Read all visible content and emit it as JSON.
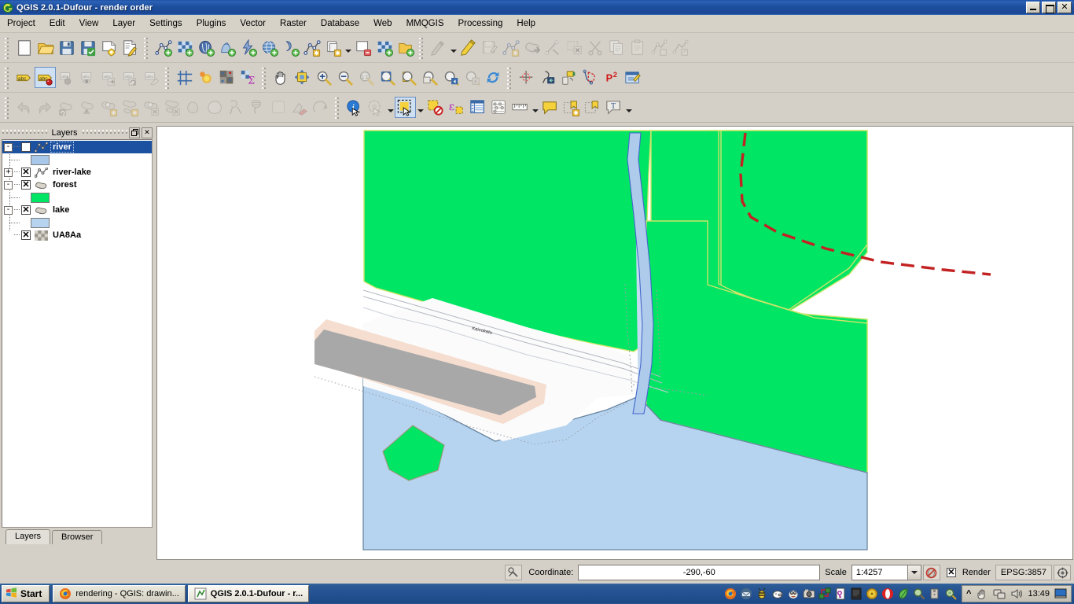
{
  "window": {
    "title": "QGIS 2.0.1-Dufour - render order",
    "app_icon": "qgis-icon",
    "buttons": {
      "minimize": "minimize-button",
      "maximize": "maximize-button",
      "close": "close-button"
    }
  },
  "menubar": {
    "items": [
      {
        "label": "Project"
      },
      {
        "label": "Edit"
      },
      {
        "label": "View"
      },
      {
        "label": "Layer"
      },
      {
        "label": "Settings"
      },
      {
        "label": "Plugins"
      },
      {
        "label": "Vector"
      },
      {
        "label": "Raster"
      },
      {
        "label": "Database"
      },
      {
        "label": "Web"
      },
      {
        "label": "MMQGIS"
      },
      {
        "label": "Processing"
      },
      {
        "label": "Help"
      }
    ]
  },
  "toolbars": {
    "row1": [
      {
        "icon": "grip"
      },
      {
        "icon": "new-project-icon"
      },
      {
        "icon": "open-project-icon"
      },
      {
        "icon": "save-project-icon"
      },
      {
        "icon": "save-project-as-icon"
      },
      {
        "icon": "new-print-composer-icon"
      },
      {
        "icon": "composer-manager-icon"
      },
      {
        "icon": "grip"
      },
      {
        "icon": "add-vector-layer-icon"
      },
      {
        "icon": "add-raster-layer-icon"
      },
      {
        "icon": "add-postgis-layer-icon"
      },
      {
        "icon": "add-spatialite-layer-icon"
      },
      {
        "icon": "add-mssql-layer-icon"
      },
      {
        "icon": "add-wcs-layer-icon"
      },
      {
        "icon": "add-wms-layer-icon"
      },
      {
        "icon": "add-delimited-text-layer-icon"
      },
      {
        "icon": "new-shapefile-layer-icon"
      },
      {
        "icon": "new-shapefile-dropdown",
        "type": "caret"
      },
      {
        "icon": "layer-properties-icon"
      },
      {
        "icon": "remove-layer-icon"
      },
      {
        "icon": "add-group-icon"
      },
      {
        "icon": "grip"
      },
      {
        "icon": "toggle-editing-icon",
        "disabled": true
      },
      {
        "icon": "toggle-editing-dropdown",
        "type": "caret"
      },
      {
        "icon": "current-edits-icon"
      },
      {
        "icon": "save-layer-edits-icon",
        "disabled": true
      },
      {
        "icon": "add-feature-icon",
        "disabled": true
      },
      {
        "icon": "move-feature-icon",
        "disabled": true
      },
      {
        "icon": "node-tool-icon",
        "disabled": true
      },
      {
        "icon": "delete-selected-icon",
        "disabled": true
      },
      {
        "icon": "cut-features-icon",
        "disabled": true
      },
      {
        "icon": "copy-features-icon",
        "disabled": true
      },
      {
        "icon": "paste-features-icon",
        "disabled": true
      },
      {
        "icon": "undo-edits-icon",
        "disabled": true
      },
      {
        "icon": "redo-edits-icon",
        "disabled": true
      }
    ],
    "row2": [
      {
        "icon": "grip"
      },
      {
        "icon": "label-icon"
      },
      {
        "icon": "label-stop-icon",
        "selected": true
      },
      {
        "icon": "label-pin-icon",
        "disabled": true
      },
      {
        "icon": "label-show-hide-icon",
        "disabled": true
      },
      {
        "icon": "label-move-icon",
        "disabled": true
      },
      {
        "icon": "label-rotate-icon",
        "disabled": true
      },
      {
        "icon": "label-change-icon",
        "disabled": true
      },
      {
        "icon": "grip"
      },
      {
        "icon": "new-grid-icon"
      },
      {
        "icon": "heatmap-icon"
      },
      {
        "icon": "raster-align-icon"
      },
      {
        "icon": "zonal-statistics-icon"
      },
      {
        "icon": "grip"
      },
      {
        "icon": "pan-map-icon"
      },
      {
        "icon": "pan-to-selection-icon"
      },
      {
        "icon": "zoom-in-icon"
      },
      {
        "icon": "zoom-out-icon"
      },
      {
        "icon": "zoom-native-icon",
        "disabled": true
      },
      {
        "icon": "zoom-full-icon"
      },
      {
        "icon": "zoom-to-selection-icon"
      },
      {
        "icon": "zoom-to-layer-icon"
      },
      {
        "icon": "zoom-last-icon"
      },
      {
        "icon": "zoom-next-icon",
        "disabled": true
      },
      {
        "icon": "refresh-icon"
      },
      {
        "icon": "grip"
      },
      {
        "icon": "georeferencer-icon"
      },
      {
        "icon": "gps-tools-icon"
      },
      {
        "icon": "gps-information-icon"
      },
      {
        "icon": "metasearch-icon"
      },
      {
        "icon": "p2-plugin-icon"
      },
      {
        "icon": "openlayers-plugin-icon"
      }
    ],
    "row3": [
      {
        "icon": "grip"
      },
      {
        "icon": "undo-icon",
        "disabled": true
      },
      {
        "icon": "redo-icon",
        "disabled": true
      },
      {
        "icon": "rotate-feature-icon",
        "disabled": true
      },
      {
        "icon": "simplify-feature-icon",
        "disabled": true
      },
      {
        "icon": "add-ring-icon",
        "disabled": true
      },
      {
        "icon": "add-part-icon",
        "disabled": true
      },
      {
        "icon": "fill-ring-icon",
        "disabled": true
      },
      {
        "icon": "delete-ring-icon",
        "disabled": true
      },
      {
        "icon": "delete-part-icon",
        "disabled": true
      },
      {
        "icon": "reshape-features-icon",
        "disabled": true
      },
      {
        "icon": "offset-curve-icon",
        "disabled": true
      },
      {
        "icon": "split-features-icon",
        "disabled": true
      },
      {
        "icon": "split-parts-icon",
        "disabled": true
      },
      {
        "icon": "merge-features-icon",
        "disabled": true
      },
      {
        "icon": "rotate-point-symbols-icon",
        "disabled": true
      },
      {
        "icon": "grip"
      },
      {
        "icon": "identify-features-icon"
      },
      {
        "icon": "run-feature-action-icon",
        "disabled": true
      },
      {
        "icon": "run-action-dropdown",
        "type": "caret"
      },
      {
        "icon": "select-features-icon",
        "selected": true
      },
      {
        "icon": "select-features-dropdown",
        "type": "caret"
      },
      {
        "icon": "deselect-features-icon"
      },
      {
        "icon": "select-by-expression-icon"
      },
      {
        "icon": "open-attribute-table-icon"
      },
      {
        "icon": "field-calculator-icon"
      },
      {
        "icon": "measure-line-icon"
      },
      {
        "icon": "measure-dropdown",
        "type": "caret"
      },
      {
        "icon": "map-tips-icon"
      },
      {
        "icon": "new-bookmark-icon"
      },
      {
        "icon": "show-bookmarks-icon"
      },
      {
        "icon": "text-annotation-icon"
      },
      {
        "icon": "annotation-dropdown",
        "type": "caret"
      }
    ]
  },
  "layers_panel": {
    "title": "Layers",
    "float_button": "float-panel-button",
    "close_button": "close-panel-button",
    "items": [
      {
        "name": "river",
        "expander": "-",
        "checked": false,
        "selected": true,
        "geom": "line",
        "symbol_color": "#a9c7e8"
      },
      {
        "name": "river-lake",
        "expander": "+",
        "checked": true,
        "selected": false,
        "geom": "line",
        "symbol_color": null
      },
      {
        "name": "forest",
        "expander": "-",
        "checked": true,
        "selected": false,
        "geom": "polygon",
        "symbol_color": "#00e563"
      },
      {
        "name": "lake",
        "expander": "-",
        "checked": true,
        "selected": false,
        "geom": "polygon",
        "symbol_color": "#b6d4f0"
      },
      {
        "name": "UA8Aa",
        "expander": "",
        "checked": true,
        "selected": false,
        "geom": "raster",
        "symbol_color": null
      }
    ],
    "tabs": [
      {
        "label": "Layers",
        "active": true
      },
      {
        "label": "Browser",
        "active": false
      }
    ]
  },
  "statusbar": {
    "message_log_icon": "message-log-icon",
    "coordinate_label": "Coordinate:",
    "coordinate_value": "-290,-60",
    "scale_label": "Scale",
    "scale_value": "1:4257",
    "scale_dropdown": "scale-dropdown-button",
    "stop_render_icon": "stop-render-icon",
    "render_checked": true,
    "render_label": "Render",
    "epsg_label": "EPSG:3857",
    "crs_status_icon": "crs-status-icon"
  },
  "taskbar": {
    "start_label": "Start",
    "tasks": [
      {
        "label": "rendering - QGIS: drawin...",
        "icon": "firefox-icon",
        "active": false
      },
      {
        "label": "QGIS 2.0.1-Dufour - r...",
        "icon": "qgis-icon",
        "active": true
      }
    ],
    "tray_icons": [
      "firefox-icon",
      "mail-icon",
      "bee-icon",
      "pig-icon",
      "gimp-icon",
      "camera-icon",
      "network-icon",
      "key-icon",
      "terminal-icon",
      "disc-icon",
      "opera-icon",
      "leaf-icon",
      "search-icon",
      "archive-icon",
      "magnifier-icon"
    ],
    "clock_tray": {
      "show_hidden_icon": "show-hidden-icons-chevron",
      "icons": [
        "hand-icon",
        "network-connection-icon",
        "volume-icon"
      ],
      "time": "13:49",
      "desktop_icon": "show-desktop-icon"
    }
  },
  "map": {
    "colors": {
      "forest": "#00e563",
      "forest_outline": "#cde56a",
      "water": "#b6d4f0",
      "water_outline": "#6a86a0",
      "river": "#a9c7e8",
      "river_outline": "#4466cc",
      "background": "#ffffff",
      "pier_sand": "#f5ded0",
      "pier_grey": "#a8a8a8",
      "road_dashed": "#c32222",
      "thin_road": "#9aa0aa"
    },
    "label": "Kaivokatu"
  }
}
